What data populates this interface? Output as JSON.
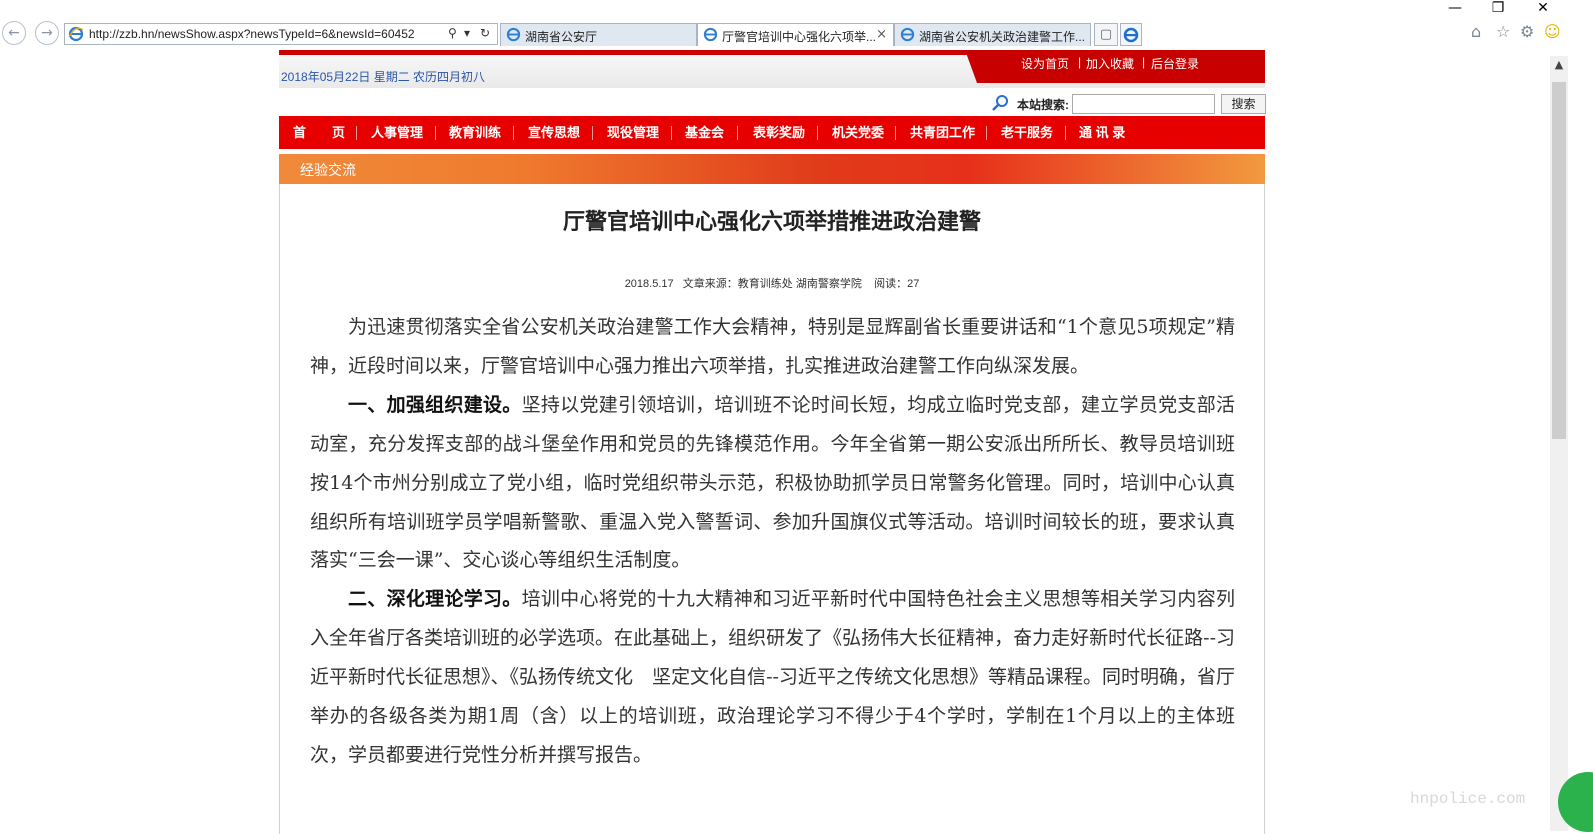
{
  "browser": {
    "address": "http://zzb.hn/newsShow.aspx?newsTypeId=6&newsId=60452",
    "tabs": [
      {
        "label": "湖南省公安厅",
        "active": false
      },
      {
        "label": "厅警官培训中心强化六项举...",
        "active": true,
        "close": "×"
      },
      {
        "label": "湖南省公安机关政治建警工作...",
        "active": false
      }
    ],
    "window_controls": [
      "—",
      "❐",
      "✕"
    ],
    "toolbar_icons": [
      "home-icon",
      "star-icon",
      "gear-icon",
      "smiley-icon"
    ]
  },
  "header": {
    "date_line": "2018年05月22日  星期二  农历四月初八",
    "links": [
      "设为首页",
      "|",
      "加入收藏",
      "|",
      "后台登录"
    ],
    "search_label": "本站搜索:",
    "search_value": "",
    "search_button": "搜索"
  },
  "nav": {
    "items": [
      "首　　页",
      "人事管理",
      "教育训练",
      "宣传思想",
      "现役管理",
      "基金会",
      "表彰奖励",
      "机关党委",
      "共青团工作",
      "老干服务",
      "通 讯 录"
    ]
  },
  "section": {
    "label": "经验交流"
  },
  "article": {
    "title": "厅警官培训中心强化六项举措推进政治建警",
    "meta": "2018.5.17   文章来源：教育训练处 湖南警察学院    阅读：27",
    "para1": "为迅速贯彻落实全省公安机关政治建警工作大会精神，特别是显辉副省长重要讲话和“1个意见5项规定”精神，近段时间以来，厅警官培训中心强力推出六项举措，扎实推进政治建警工作向纵深发展。",
    "para2_head": "一、加强组织建设。",
    "para2": "坚持以党建引领培训，培训班不论时间长短，均成立临时党支部，建立学员党支部活动室，充分发挥支部的战斗堡垒作用和党员的先锋模范作用。今年全省第一期公安派出所所长、教导员培训班按14个市州分别成立了党小组，临时党组织带头示范，积极协助抓学员日常警务化管理。同时，培训中心认真组织所有培训班学员学唱新警歌、重温入党入警誓词、参加升国旗仪式等活动。培训时间较长的班，要求认真落实“三会一课”、交心谈心等组织生活制度。",
    "para3_head": "二、深化理论学习。",
    "para3": "培训中心将党的十九大精神和习近平新时代中国特色社会主义思想等相关学习内容列入全年省厅各类培训班的必学选项。在此基础上，组织研发了《弘扬伟大长征精神，奋力走好新时代长征路--习近平新时代长征思想》、《弘扬传统文化　坚定文化自信--习近平之传统文化思想》等精品课程。同时明确，省厅举办的各级各类为期1周（含）以上的培训班，政治理论学习不得少于4个学时，学制在1个月以上的主体班次，学员都要进行党性分析并撰写报告。"
  },
  "watermark": "hnpolice.com"
}
